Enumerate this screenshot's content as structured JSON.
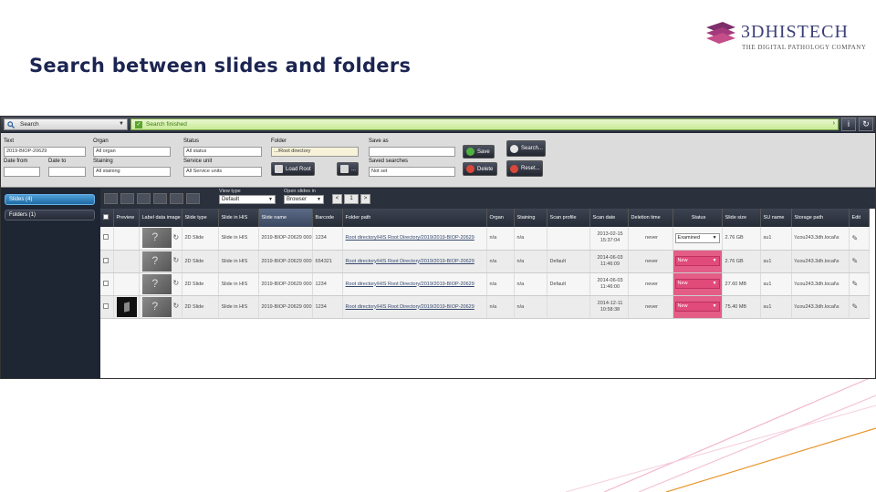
{
  "slide": {
    "title": "Search between slides and folders",
    "logo_name": "3DHISTECH",
    "logo_tagline": "The Digital Pathology Company"
  },
  "app": {
    "search_mode": "Search",
    "status_message": "Search finished",
    "filters": {
      "text_label": "Text",
      "text_value": "2019-BIOP-20629",
      "date_from_label": "Date from",
      "date_to_label": "Date to",
      "organ_label": "Organ",
      "organ_value": "All organ",
      "staining_label": "Staining",
      "staining_value": "All staining",
      "status_label": "Status",
      "status_value": "All status",
      "service_unit_label": "Service unit",
      "service_unit_value": "All Service units",
      "folder_label": "Folder",
      "folder_value": ".../Root directory",
      "load_root_label": "Load Root",
      "save_as_label": "Save as",
      "saved_searches_label": "Saved searches",
      "saved_searches_value": "Not set",
      "save_button": "Save",
      "delete_button": "Delete",
      "search_button": "Search...",
      "reset_button": "Reset..."
    },
    "sidebar": {
      "tabs": [
        {
          "label": "Slides (4)"
        },
        {
          "label": "Folders (1)"
        }
      ]
    },
    "toolbar": {
      "view_type_label": "View type",
      "view_type_value": "Default",
      "open_slides_label": "Open slides in",
      "open_slides_value": "Browser",
      "pager": [
        "<",
        "1",
        ">"
      ]
    },
    "table": {
      "columns": [
        "",
        "Preview",
        "Label data image",
        "Slide type",
        "Slide in HIS",
        "Slide name",
        "Barcode",
        "Folder path",
        "Organ",
        "Staining",
        "Scan profile",
        "Scan date",
        "Deletion time",
        "Status",
        "Slide size",
        "SU name",
        "Storage path",
        "Edit"
      ],
      "rows": [
        {
          "preview": "",
          "slide_type": "2D Slide",
          "in_his": "Slide in HIS",
          "name": "2019-BIOP-20629 000",
          "barcode": "1234",
          "folder_path": "Root directory/HIS Root Directory/2019/2019-BIOP-20629",
          "organ": "n/a",
          "staining": "n/a",
          "scan_profile": "",
          "scan_date": "2013-02-15 15:37:04",
          "deletion": "never",
          "status": "Examined",
          "size": "2.76 GB",
          "su_name": "su1",
          "storage": "\\\\cou243.3dh.local\\s"
        },
        {
          "preview": "",
          "slide_type": "2D Slide",
          "in_his": "Slide in HIS",
          "name": "2019-BIOP-20629 000",
          "barcode": "654321",
          "folder_path": "Root directory/HIS Root Directory/2019/2019-BIOP-20629",
          "organ": "n/a",
          "staining": "n/a",
          "scan_profile": "Default",
          "scan_date": "2014-06-03 11:46:09",
          "deletion": "never",
          "status": "New",
          "size": "2.76 GB",
          "su_name": "su1",
          "storage": "\\\\cou243.3dh.local\\s"
        },
        {
          "preview": "",
          "slide_type": "2D Slide",
          "in_his": "Slide in HIS",
          "name": "2019-BIOP-20629 000",
          "barcode": "1234",
          "folder_path": "Root directory/HIS Root Directory/2019/2019-BIOP-20629",
          "organ": "n/a",
          "staining": "n/a",
          "scan_profile": "Default",
          "scan_date": "2014-06-03 11:46:00",
          "deletion": "never",
          "status": "New",
          "size": "27.60 MB",
          "su_name": "su1",
          "storage": "\\\\cou243.3dh.local\\s"
        },
        {
          "preview": "dark",
          "slide_type": "2D Slide",
          "in_his": "Slide in HIS",
          "name": "2019-BIOP-20629 000",
          "barcode": "1234",
          "folder_path": "Root directory/HIS Root Directory/2019/2019-BIOP-20629",
          "organ": "n/a",
          "staining": "n/a",
          "scan_profile": "",
          "scan_date": "2014-12-11 10:58:38",
          "deletion": "never",
          "status": "New",
          "size": "75.40 MB",
          "su_name": "su1",
          "storage": "\\\\cou243.3dh.local\\s"
        }
      ]
    }
  },
  "colors": {
    "title": "#1c2551",
    "status_new": "#e04b7a",
    "accent_line": "#e8962f",
    "deco_line": "#f2b8cf"
  }
}
